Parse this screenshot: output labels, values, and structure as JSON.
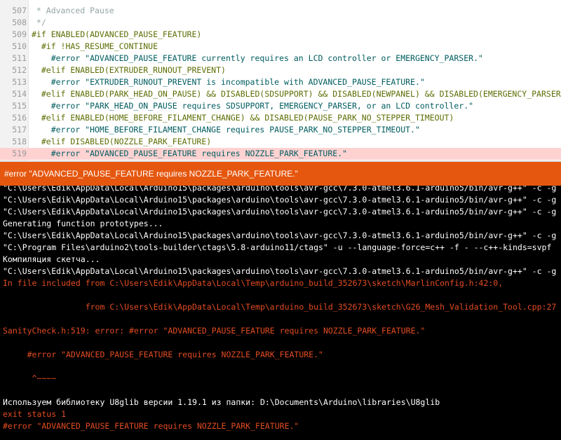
{
  "editor": {
    "lines": [
      {
        "num": "507",
        "text": " * Advanced Pause",
        "kind": "comment"
      },
      {
        "num": "508",
        "text": " */",
        "kind": "comment"
      },
      {
        "num": "509",
        "text": "#if ENABLED(ADVANCED_PAUSE_FEATURE)",
        "kind": "dir"
      },
      {
        "num": "510",
        "text": "  #if !HAS_RESUME_CONTINUE",
        "kind": "dir"
      },
      {
        "num": "511",
        "text": "    #error \"ADVANCED_PAUSE_FEATURE currently requires an LCD controller or EMERGENCY_PARSER.\"",
        "kind": "err"
      },
      {
        "num": "512",
        "text": "  #elif ENABLED(EXTRUDER_RUNOUT_PREVENT)",
        "kind": "dir"
      },
      {
        "num": "513",
        "text": "    #error \"EXTRUDER_RUNOUT_PREVENT is incompatible with ADVANCED_PAUSE_FEATURE.\"",
        "kind": "err"
      },
      {
        "num": "514",
        "text": "  #elif ENABLED(PARK_HEAD_ON_PAUSE) && DISABLED(SDSUPPORT) && DISABLED(NEWPANEL) && DISABLED(EMERGENCY_PARSER)",
        "kind": "dir"
      },
      {
        "num": "515",
        "text": "    #error \"PARK_HEAD_ON_PAUSE requires SDSUPPORT, EMERGENCY_PARSER, or an LCD controller.\"",
        "kind": "err"
      },
      {
        "num": "516",
        "text": "  #elif ENABLED(HOME_BEFORE_FILAMENT_CHANGE) && DISABLED(PAUSE_PARK_NO_STEPPER_TIMEOUT)",
        "kind": "dir"
      },
      {
        "num": "517",
        "text": "    #error \"HOME_BEFORE_FILAMENT_CHANGE requires PAUSE_PARK_NO_STEPPER_TIMEOUT.\"",
        "kind": "err"
      },
      {
        "num": "518",
        "text": "  #elif DISABLED(NOZZLE_PARK_FEATURE)",
        "kind": "dir"
      },
      {
        "num": "519",
        "text": "    #error \"ADVANCED_PAUSE_FEATURE requires NOZZLE_PARK_FEATURE.\"",
        "kind": "err",
        "highlight": true
      }
    ]
  },
  "status_bar": {
    "message": "#error \"ADVANCED_PAUSE_FEATURE requires NOZZLE_PARK_FEATURE.\"",
    "color": "#e5570f"
  },
  "console": {
    "lines": [
      {
        "text": "\"C:\\Users\\Edik\\AppData\\Local\\Arduino15\\packages\\arduino\\tools\\avr-gcc\\7.3.0-atmel3.6.1-arduino5/bin/avr-g++\" -c -g",
        "color": "white"
      },
      {
        "text": "\"C:\\Users\\Edik\\AppData\\Local\\Arduino15\\packages\\arduino\\tools\\avr-gcc\\7.3.0-atmel3.6.1-arduino5/bin/avr-g++\" -c -g",
        "color": "white"
      },
      {
        "text": "\"C:\\Users\\Edik\\AppData\\Local\\Arduino15\\packages\\arduino\\tools\\avr-gcc\\7.3.0-atmel3.6.1-arduino5/bin/avr-g++\" -c -g",
        "color": "white"
      },
      {
        "text": "Generating function prototypes...",
        "color": "white"
      },
      {
        "text": "\"C:\\Users\\Edik\\AppData\\Local\\Arduino15\\packages\\arduino\\tools\\avr-gcc\\7.3.0-atmel3.6.1-arduino5/bin/avr-g++\" -c -g",
        "color": "white"
      },
      {
        "text": "\"C:\\Program Files\\arduino2\\tools-builder\\ctags\\5.8-arduino11/ctags\" -u --language-force=c++ -f - --c++-kinds=svpf",
        "color": "white"
      },
      {
        "text": "Компиляция скетча...",
        "color": "white"
      },
      {
        "text": "\"C:\\Users\\Edik\\AppData\\Local\\Arduino15\\packages\\arduino\\tools\\avr-gcc\\7.3.0-atmel3.6.1-arduino5/bin/avr-g++\" -c -g",
        "color": "white"
      },
      {
        "text": "In file included from C:\\Users\\Edik\\AppData\\Local\\Temp\\arduino_build_352673\\sketch\\MarlinConfig.h:42:0,",
        "color": "red"
      },
      {
        "text": "",
        "color": "red"
      },
      {
        "text": "                 from C:\\Users\\Edik\\AppData\\Local\\Temp\\arduino_build_352673\\sketch\\G26_Mesh_Validation_Tool.cpp:27",
        "color": "red"
      },
      {
        "text": "",
        "color": "red"
      },
      {
        "text": "SanityCheck.h:519: error: #error \"ADVANCED_PAUSE_FEATURE requires NOZZLE_PARK_FEATURE.\"",
        "color": "red"
      },
      {
        "text": "",
        "color": "red"
      },
      {
        "text": "     #error \"ADVANCED_PAUSE_FEATURE requires NOZZLE_PARK_FEATURE.\"",
        "color": "red"
      },
      {
        "text": "",
        "color": "red"
      },
      {
        "text": "      ^~~~~",
        "color": "red"
      },
      {
        "text": "",
        "color": "red"
      },
      {
        "text": "Используем библиотеку U8glib версии 1.19.1 из папки: D:\\Documents\\Arduino\\libraries\\U8glib",
        "color": "white"
      },
      {
        "text": "exit status 1",
        "color": "red"
      },
      {
        "text": "#error \"ADVANCED_PAUSE_FEATURE requires NOZZLE_PARK_FEATURE.\"",
        "color": "red"
      }
    ]
  }
}
